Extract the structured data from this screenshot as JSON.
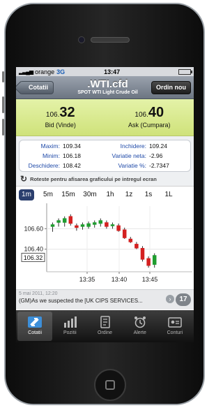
{
  "status": {
    "carrier": "orange",
    "network": "3G",
    "time": "13:47"
  },
  "nav": {
    "back_label": "Cotatii",
    "symbol": ".WTI.cfd",
    "subtitle": "SPOT WTI Light Crude Oil",
    "order_label": "Ordin nou"
  },
  "prices": {
    "bid": {
      "prefix": "106.",
      "big": "32",
      "label": "Bid (Vinde)"
    },
    "ask": {
      "prefix": "106.",
      "big": "40",
      "label": "Ask (Cumpara)"
    }
  },
  "stats": {
    "maxim_label": "Maxim:",
    "maxim": "109.34",
    "inchidere_label": "Inchidere:",
    "inchidere": "109.24",
    "minim_label": "Minim:",
    "minim": "106.18",
    "var_neta_label": "Variatie neta:",
    "var_neta": "-2.96",
    "deschidere_label": "Deschidere:",
    "deschidere": "108.42",
    "var_pct_label": "Variatie %:",
    "var_pct": "-2.7347"
  },
  "rotate_hint": "Roteste pentru afisarea graficului pe intregul ecran",
  "timeframes": [
    "1m",
    "5m",
    "15m",
    "30m",
    "1h",
    "1z",
    "1s",
    "1L"
  ],
  "active_timeframe": "1m",
  "chart_data": {
    "type": "candlestick",
    "y_tick_labels": [
      "106.60",
      "106.40"
    ],
    "current_price_label": "106.32",
    "x_tick_labels": [
      "13:35",
      "13:40",
      "13:45"
    ],
    "ylim": [
      106.18,
      106.82
    ],
    "colors": {
      "up": "#1f9d2f",
      "down": "#d42020"
    },
    "candles": [
      {
        "o": 106.62,
        "h": 106.66,
        "l": 106.57,
        "c": 106.64
      },
      {
        "o": 106.66,
        "h": 106.7,
        "l": 106.62,
        "c": 106.68
      },
      {
        "o": 106.66,
        "h": 106.72,
        "l": 106.62,
        "c": 106.7
      },
      {
        "o": 106.72,
        "h": 106.74,
        "l": 106.63,
        "c": 106.65
      },
      {
        "o": 106.63,
        "h": 106.65,
        "l": 106.58,
        "c": 106.61
      },
      {
        "o": 106.62,
        "h": 106.66,
        "l": 106.59,
        "c": 106.64
      },
      {
        "o": 106.62,
        "h": 106.67,
        "l": 106.6,
        "c": 106.65
      },
      {
        "o": 106.64,
        "h": 106.68,
        "l": 106.61,
        "c": 106.66
      },
      {
        "o": 106.65,
        "h": 106.7,
        "l": 106.62,
        "c": 106.68
      },
      {
        "o": 106.66,
        "h": 106.68,
        "l": 106.6,
        "c": 106.62
      },
      {
        "o": 106.63,
        "h": 106.66,
        "l": 106.6,
        "c": 106.64
      },
      {
        "o": 106.63,
        "h": 106.65,
        "l": 106.57,
        "c": 106.58
      },
      {
        "o": 106.59,
        "h": 106.61,
        "l": 106.5,
        "c": 106.51
      },
      {
        "o": 106.5,
        "h": 106.52,
        "l": 106.46,
        "c": 106.47
      },
      {
        "o": 106.45,
        "h": 106.47,
        "l": 106.4,
        "c": 106.41
      },
      {
        "o": 106.41,
        "h": 106.43,
        "l": 106.28,
        "c": 106.3
      },
      {
        "o": 106.31,
        "h": 106.33,
        "l": 106.22,
        "c": 106.24
      },
      {
        "o": 106.25,
        "h": 106.36,
        "l": 106.22,
        "c": 106.34
      }
    ]
  },
  "news": {
    "date": "5 mai 2011, 12:20",
    "text": "(GM)As we suspected the [UK CIPS SERVICES...",
    "count": "17"
  },
  "tabs": [
    {
      "label": "Cotatii",
      "icon": "quotes-arrows-icon",
      "active": true
    },
    {
      "label": "Pozitii",
      "icon": "positions-bars-icon",
      "active": false
    },
    {
      "label": "Ordine",
      "icon": "orders-document-icon",
      "active": false
    },
    {
      "label": "Alerte",
      "icon": "alarm-clock-icon",
      "active": false
    },
    {
      "label": "Conturi",
      "icon": "accounts-card-icon",
      "active": false
    }
  ]
}
